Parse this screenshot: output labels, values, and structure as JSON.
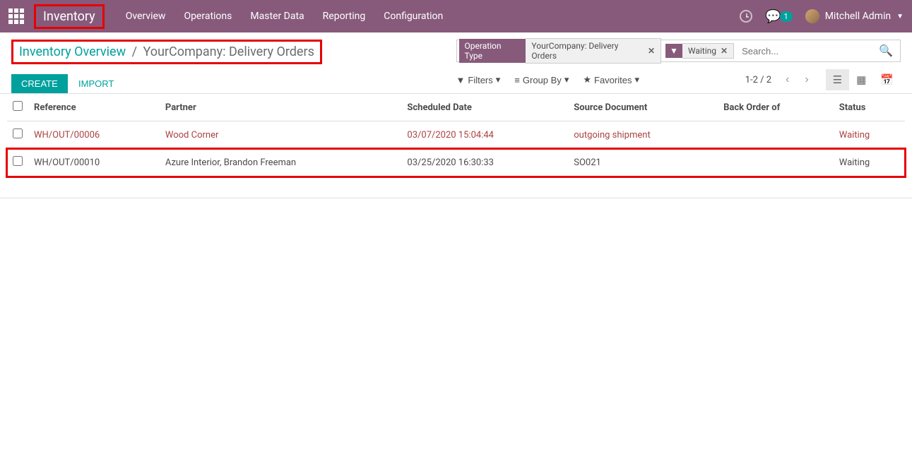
{
  "header": {
    "app_title": "Inventory",
    "menu": [
      "Overview",
      "Operations",
      "Master Data",
      "Reporting",
      "Configuration"
    ],
    "chat_count": "1",
    "user_name": "Mitchell Admin"
  },
  "breadcrumb": {
    "parent": "Inventory Overview",
    "current": "YourCompany: Delivery Orders"
  },
  "buttons": {
    "create": "CREATE",
    "import": "IMPORT"
  },
  "search": {
    "facets": [
      {
        "label": "Operation Type",
        "value": "YourCompany: Delivery Orders"
      },
      {
        "icon": "filter",
        "value": "Waiting"
      }
    ],
    "placeholder": "Search..."
  },
  "toolbar": {
    "filters": "Filters",
    "groupby": "Group By",
    "favorites": "Favorites",
    "pager": "1-2 / 2"
  },
  "table": {
    "headers": {
      "reference": "Reference",
      "partner": "Partner",
      "scheduled": "Scheduled Date",
      "source": "Source Document",
      "backorder": "Back Order of",
      "status": "Status"
    },
    "rows": [
      {
        "reference": "WH/OUT/00006",
        "partner": "Wood Corner",
        "scheduled": "03/07/2020 15:04:44",
        "source": "outgoing shipment",
        "backorder": "",
        "status": "Waiting",
        "danger": true,
        "highlight": false
      },
      {
        "reference": "WH/OUT/00010",
        "partner": "Azure Interior, Brandon Freeman",
        "scheduled": "03/25/2020 16:30:33",
        "source": "SO021",
        "backorder": "",
        "status": "Waiting",
        "danger": false,
        "highlight": true
      }
    ]
  }
}
